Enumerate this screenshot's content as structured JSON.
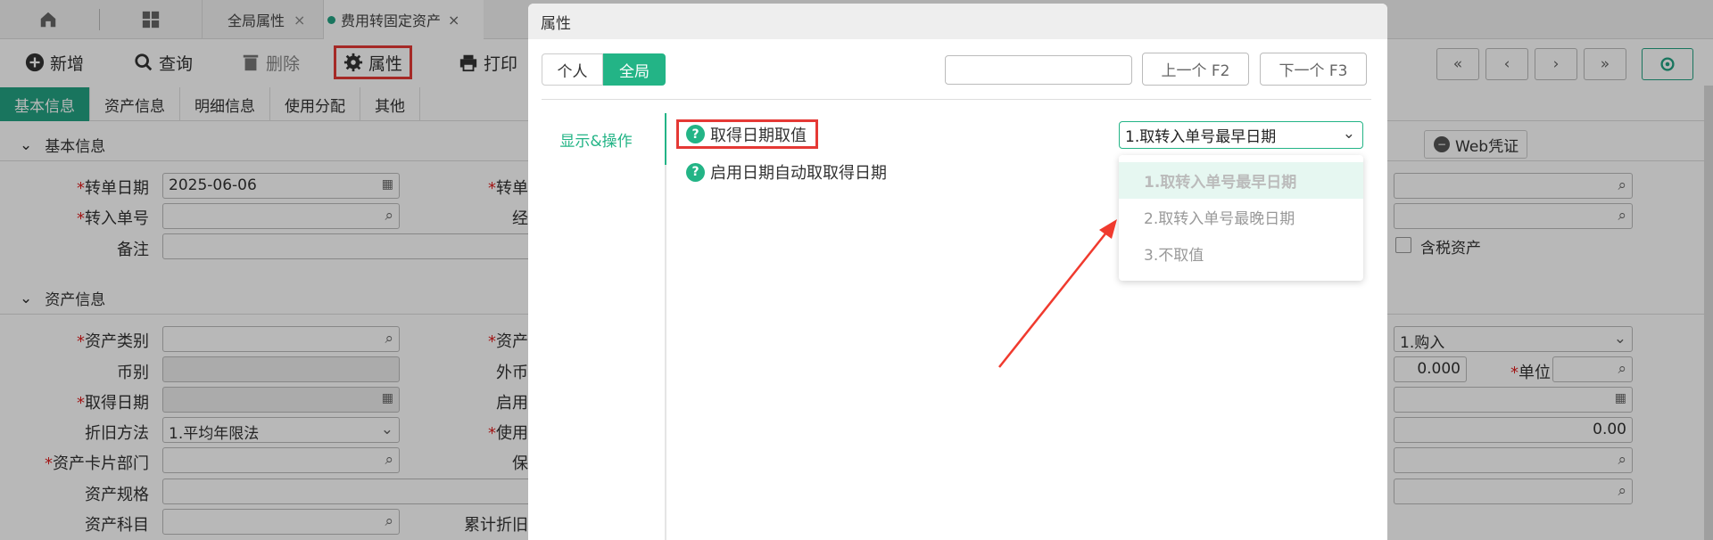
{
  "topbar": {
    "home_icon": "home-icon",
    "apps_icon": "grid-icon",
    "tabs": [
      {
        "label": "全局属性",
        "close": "×"
      },
      {
        "label": "费用转固定资产",
        "close": "×"
      }
    ]
  },
  "toolbar": {
    "add_label": "新增",
    "query_label": "查询",
    "delete_label": "删除",
    "attr_label": "属性",
    "print_label": "打印"
  },
  "subtabs": [
    "基本信息",
    "资产信息",
    "明细信息",
    "使用分配",
    "其他"
  ],
  "sections": {
    "basic": "基本信息",
    "asset": "资产信息"
  },
  "form": {
    "transfer_date_label": "转单日期",
    "transfer_date_value": "2025-06-06",
    "transfer_no_label": "转入单号",
    "remark_label": "备注",
    "col2_row1": "转单",
    "col2_row2": "经",
    "asset_category_label": "资产类别",
    "currency_label": "币别",
    "acquire_date_label": "取得日期",
    "depr_method_label": "折旧方法",
    "depr_method_value": "1.平均年限法",
    "card_dept_label": "资产卡片部门",
    "spec_label": "资产规格",
    "subject_label": "资产科目",
    "col2_a": "资产",
    "col2_b": "外币",
    "col2_c": "启用",
    "col2_d": "使用",
    "col2_e": "保",
    "col2_f": "累计折旧"
  },
  "right_form": {
    "web_voucher": "Web凭证",
    "tax_asset": "含税资产",
    "purchase": "1.购入",
    "amount": "0.000",
    "unit_label": "单位",
    "amount2": "0.00"
  },
  "dialog": {
    "title": "属性",
    "seg_personal": "个人",
    "seg_global": "全局",
    "search_placeholder": "",
    "prev_button": "上一个 F2",
    "next_button": "下一个 F3",
    "side_nav": "显示&操作",
    "row1_label": "取得日期取值",
    "row2_label": "启用日期自动取取得日期",
    "select_value": "1.取转入单号最早日期",
    "options": [
      "1.取转入单号最早日期",
      "2.取转入单号最晚日期",
      "3.不取值"
    ],
    "accent_color": "#23b486",
    "highlight_color": "#e53935"
  }
}
